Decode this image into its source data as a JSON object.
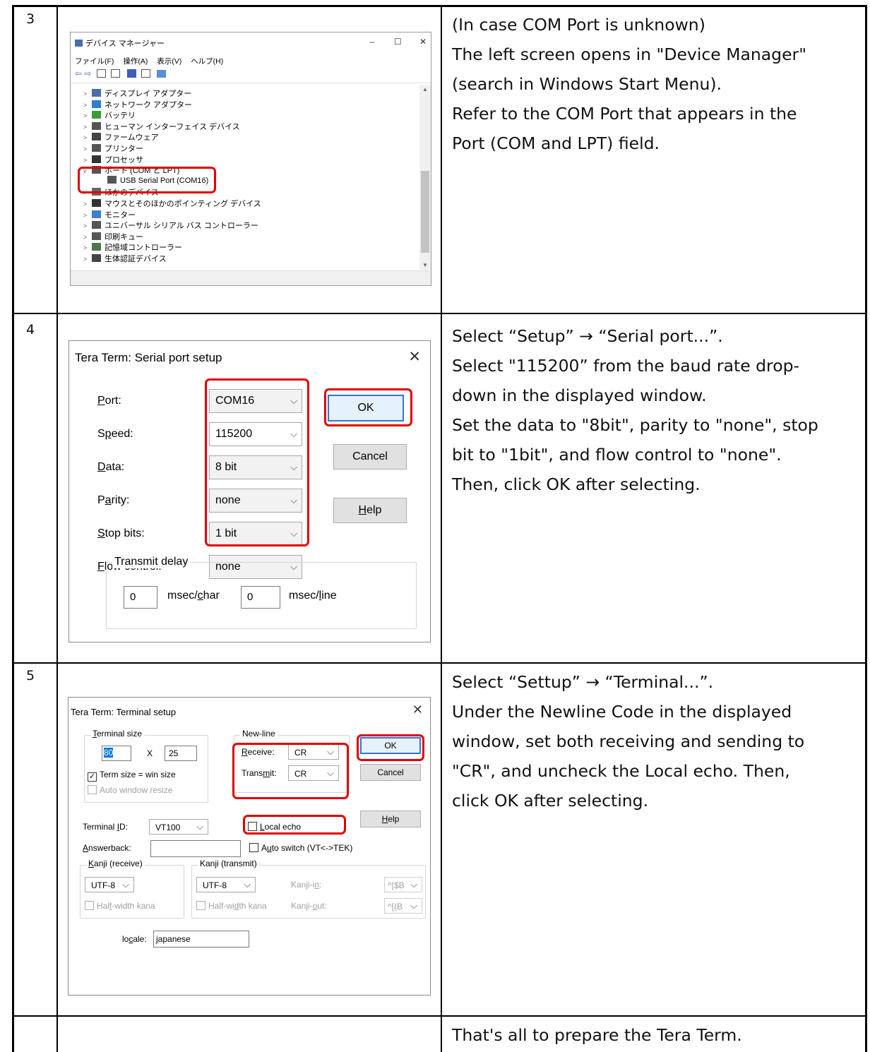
{
  "steps": [
    {
      "number": "3",
      "description_lines": [
        " (In case COM Port is unknown)",
        "The left screen opens in \"Device Manager\"",
        "(search in Windows Start Menu).",
        "Refer to the COM Port that appears in the",
        "Port (COM and LPT) field."
      ],
      "screenshot": {
        "title": "デバイス マネージャー",
        "window_controls": [
          "–",
          "☐",
          "✕"
        ],
        "menu": [
          "ファイル(F)",
          "操作(A)",
          "表示(V)",
          "ヘルプ(H)"
        ],
        "tree": [
          {
            "chevron": ">",
            "label": "ディスプレイ アダプター",
            "icon": "display-adapter-icon"
          },
          {
            "chevron": ">",
            "label": "ネットワーク アダプター",
            "icon": "network-adapter-icon"
          },
          {
            "chevron": ">",
            "label": "バッテリ",
            "icon": "battery-icon"
          },
          {
            "chevron": ">",
            "label": "ヒューマン インターフェイス デバイス",
            "icon": "hid-icon"
          },
          {
            "chevron": ">",
            "label": "ファームウェア",
            "icon": "firmware-icon"
          },
          {
            "chevron": ">",
            "label": "プリンター",
            "icon": "printer-icon"
          },
          {
            "chevron": ">",
            "label": "プロセッサ",
            "icon": "processor-icon"
          },
          {
            "chevron": "v",
            "label": "ポート (COM と LPT)",
            "icon": "port-icon"
          },
          {
            "chevron": "",
            "label": "USB Serial Port (COM16)",
            "icon": "usb-serial-icon",
            "child": true
          },
          {
            "chevron": ">",
            "label": "ほかのデバイス",
            "icon": "other-device-icon"
          },
          {
            "chevron": ">",
            "label": "マウスとそのほかのポインティング デバイス",
            "icon": "mouse-icon"
          },
          {
            "chevron": ">",
            "label": "モニター",
            "icon": "monitor-icon"
          },
          {
            "chevron": ">",
            "label": "ユニバーサル シリアル バス コントローラー",
            "icon": "usb-controller-icon"
          },
          {
            "chevron": ">",
            "label": "印刷キュー",
            "icon": "print-queue-icon"
          },
          {
            "chevron": ">",
            "label": "記憶域コントローラー",
            "icon": "storage-controller-icon"
          },
          {
            "chevron": ">",
            "label": "生体認証デバイス",
            "icon": "biometric-icon"
          }
        ]
      }
    },
    {
      "number": "4",
      "description_lines": [
        "Select “Setup” → “Serial port...”.",
        "Select \"115200” from the baud rate drop-",
        "down in the displayed window.",
        "Set the data to \"8bit\", parity to \"none\", stop",
        "bit to \"1bit\", and flow control to \"none\".",
        "Then, click OK after selecting."
      ],
      "screenshot": {
        "title": "Tera Term: Serial port setup",
        "close": "✕",
        "fields": [
          {
            "label": "Port:",
            "value": "COM16"
          },
          {
            "label": "Speed:",
            "value": "115200"
          },
          {
            "label": "Data:",
            "value": "8 bit"
          },
          {
            "label": "Parity:",
            "value": "none"
          },
          {
            "label": "Stop bits:",
            "value": "1 bit"
          },
          {
            "label": "Flow control:",
            "value": "none"
          }
        ],
        "buttons": {
          "ok": "OK",
          "cancel": "Cancel",
          "help": "Help"
        },
        "transmit_delay": {
          "legend": "Transmit delay",
          "char_value": "0",
          "char_unit": "msec/char",
          "line_value": "0",
          "line_unit": "msec/line"
        }
      }
    },
    {
      "number": "5",
      "description_lines": [
        "Select “Settup” → “Terminal...”.",
        "Under the Newline Code in the displayed",
        "window, set both receiving and sending to",
        "\"CR\", and uncheck the Local echo. Then,",
        "click OK after selecting."
      ],
      "screenshot": {
        "title": "Tera Term: Terminal setup",
        "close": "✕",
        "terminal_size": {
          "legend": "Terminal size",
          "cols": "80",
          "x": "X",
          "rows": "25",
          "term_eq_win": "Term size = win size",
          "auto_resize": "Auto window resize"
        },
        "newline": {
          "legend": "New-line",
          "receive_label": "Receive:",
          "receive_value": "CR",
          "transmit_label": "Transmit:",
          "transmit_value": "CR"
        },
        "buttons": {
          "ok": "OK",
          "cancel": "Cancel",
          "help": "Help"
        },
        "terminal_id": {
          "label": "Terminal ID:",
          "value": "VT100"
        },
        "local_echo": "Local echo",
        "answerback": {
          "label": "Answerback:",
          "value": ""
        },
        "auto_switch": "Auto switch (VT<->TEK)",
        "kanji_receive": {
          "legend": "Kanji (receive)",
          "value": "UTF-8",
          "half_width": "Half-width kana"
        },
        "kanji_transmit": {
          "legend": "Kanji (transmit)",
          "value": "UTF-8",
          "half_width": "Half-width kana",
          "kanji_in_label": "Kanji-in:",
          "kanji_in_value": "^[$B",
          "kanji_out_label": "Kanji-out:",
          "kanji_out_value": "^[(B"
        },
        "locale": {
          "label": "locale:",
          "value": "japanese"
        }
      }
    },
    {
      "number": "",
      "description_lines": [
        "That's all to prepare the Tera Term."
      ]
    }
  ]
}
